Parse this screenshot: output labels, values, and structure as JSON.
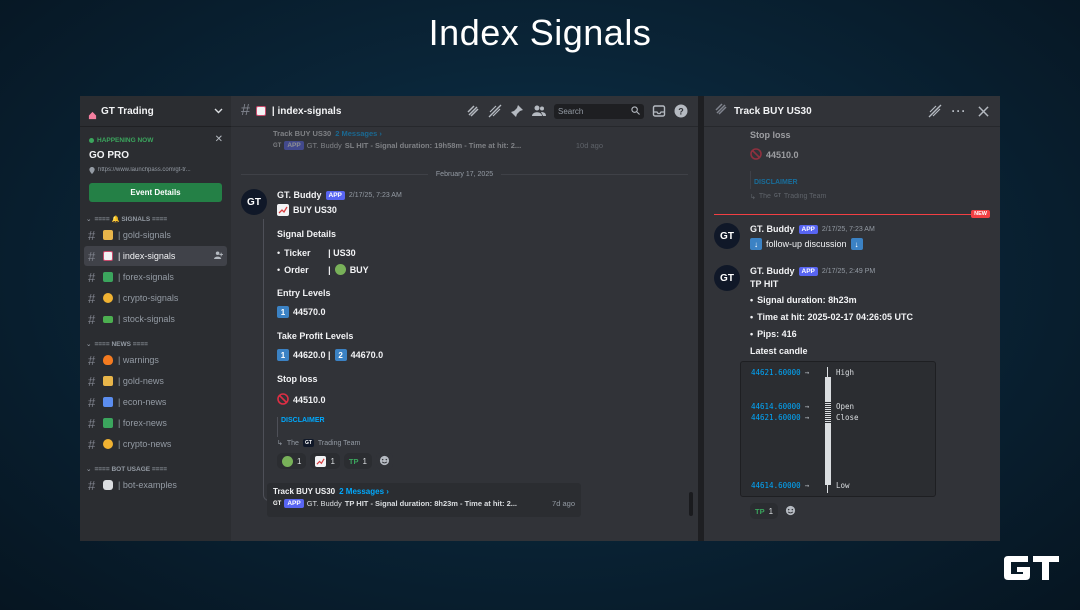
{
  "page_title": "Index Signals",
  "sidebar": {
    "server_name": "GT Trading",
    "event": {
      "happening": "HAPPENING NOW",
      "title": "GO PRO",
      "url": "https://www.launchpass.com/gt-tr...",
      "button": "Event Details"
    },
    "categories": [
      {
        "label": "==== 🔔 SIGNALS ===="
      },
      {
        "label": "==== NEWS ===="
      },
      {
        "label": "==== BOT USAGE ===="
      }
    ],
    "channels": [
      {
        "label": "| gold-signals",
        "color": "#e8b54a"
      },
      {
        "label": "| index-signals",
        "color": "#c94b6d"
      },
      {
        "label": "| forex-signals",
        "color": "#3ba55d"
      },
      {
        "label": "| crypto-signals",
        "color": "#f0b232"
      },
      {
        "label": "| stock-signals",
        "color": "#4caf50"
      },
      {
        "label": "| warnings",
        "color": "#f47b20"
      },
      {
        "label": "| gold-news",
        "color": "#e8b54a"
      },
      {
        "label": "| econ-news",
        "color": "#5b8def"
      },
      {
        "label": "| forex-news",
        "color": "#3ba55d"
      },
      {
        "label": "| crypto-news",
        "color": "#f0b232"
      },
      {
        "label": "| bot-examples",
        "color": "#dbdee1"
      }
    ]
  },
  "main": {
    "channel_name": "| index-signals",
    "search_placeholder": "Search",
    "faded_thread": {
      "title": "Track BUY US30",
      "count": "2 Messages ›",
      "author": "GT. Buddy",
      "text": "SL HIT - Signal duration: 19h58m - Time at hit: 2...",
      "time": "10d ago"
    },
    "date_divider": "February 17, 2025",
    "message": {
      "author": "GT. Buddy",
      "app_tag": "APP",
      "timestamp": "2/17/25, 7:23 AM",
      "title": "BUY US30",
      "signal_details": "Signal Details",
      "ticker_label": "Ticker",
      "ticker_value": "| US30",
      "order_label": "Order",
      "order_value": "BUY",
      "entry_levels": "Entry Levels",
      "entry_num": "1",
      "entry_value": "44570.0",
      "tp_levels": "Take Profit Levels",
      "tp1_num": "1",
      "tp1_value": "44620.0 |",
      "tp2_num": "2",
      "tp2_value": "44670.0",
      "stop_loss": "Stop loss",
      "sl_value": "44510.0",
      "disclaimer": "DISCLAIMER",
      "team_prefix": "The",
      "team_suffix": "Trading Team",
      "reactions": [
        {
          "count": "1"
        },
        {
          "count": "1"
        },
        {
          "label": "TP",
          "count": "1"
        }
      ]
    },
    "thread_box": {
      "title": "Track BUY US30",
      "count": "2 Messages ›",
      "author": "GT. Buddy",
      "text": "TP HIT - Signal duration: 8h23m - Time at hit: 2...",
      "time": "7d ago"
    }
  },
  "thread": {
    "title": "Track BUY US30",
    "top": {
      "stop_loss": "Stop loss",
      "sl_value": "44510.0",
      "disclaimer": "DISCLAIMER",
      "team_suffix": "Trading Team",
      "team_prefix": "The"
    },
    "new_badge": "NEW",
    "msg1": {
      "author": "GT. Buddy",
      "app_tag": "APP",
      "timestamp": "2/17/25, 7:23 AM",
      "text": "follow-up discussion"
    },
    "msg2": {
      "author": "GT. Buddy",
      "app_tag": "APP",
      "timestamp": "2/17/25, 2:49 PM",
      "title": "TP HIT",
      "b1": "Signal duration: 8h23m",
      "b2": "Time at hit: 2025-02-17 04:26:05 UTC",
      "b3": "Pips: 416",
      "latest_candle": "Latest candle",
      "candle": {
        "high_val": "44621.60000",
        "high_lbl": "High",
        "open_val": "44614.60000",
        "open_lbl": "Open",
        "close_val": "44621.60000",
        "close_lbl": "Close",
        "low_val": "44614.60000",
        "low_lbl": "Low",
        "arrow": "→"
      },
      "reaction_label": "TP",
      "reaction_count": "1"
    }
  },
  "colors": {
    "discord_bg": "#313338",
    "sidebar_bg": "#2b2d31",
    "accent_blue": "#00a8fc",
    "green": "#248046",
    "red": "#f23f43"
  }
}
